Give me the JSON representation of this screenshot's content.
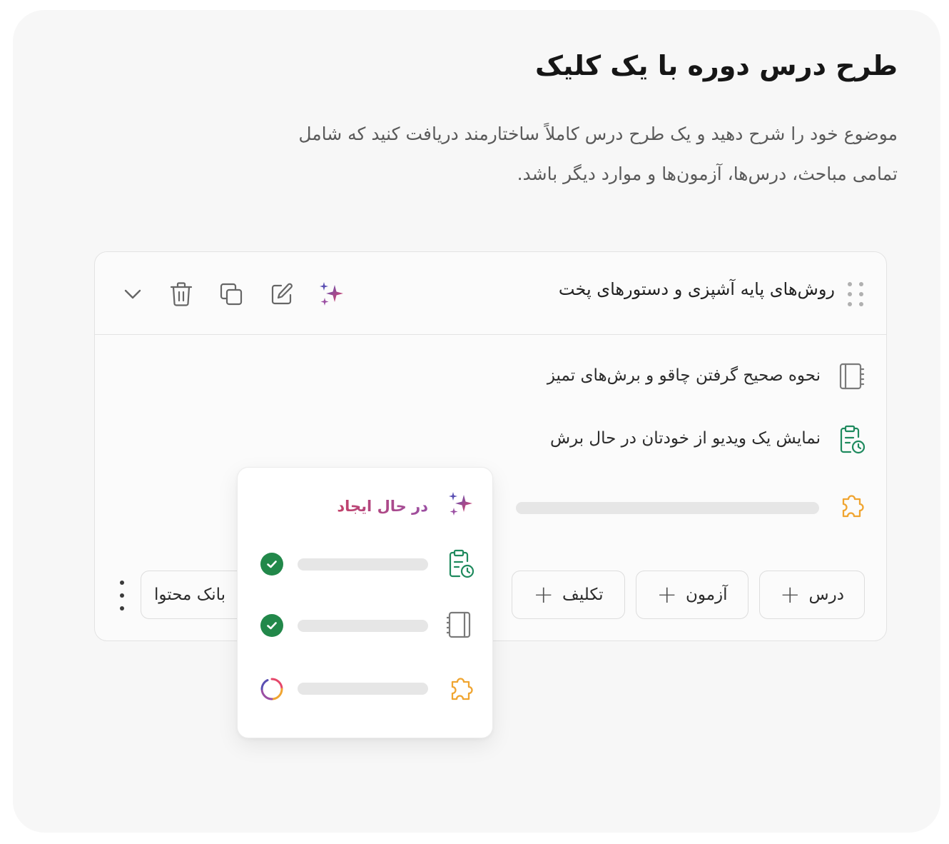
{
  "hero": {
    "title": "طرح درس دوره با یک کلیک",
    "description": "موضوع خود را شرح دهید و یک طرح درس کاملاً ساختارمند دریافت کنید که شامل تمامی مباحث، درس‌ها، آزمون‌ها و موارد دیگر باشد."
  },
  "module": {
    "title": "روش‌های پایه آشپزی و دستورهای پخت",
    "toolbar": [
      "sparkles-icon",
      "edit-icon",
      "duplicate-icon",
      "delete-icon",
      "chevron-down-icon"
    ],
    "items": [
      {
        "icon": "notebook-icon",
        "label": "نحوه صحیح گرفتن چاقو و برش‌های تمیز"
      },
      {
        "icon": "clipboard-clock-icon",
        "label": "نمایش یک ویدیو از خودتان در حال برش"
      },
      {
        "icon": "puzzle-icon",
        "label": ""
      }
    ],
    "actions": {
      "lesson": "درس",
      "quiz": "آزمون",
      "assignment": "تکلیف",
      "content_bank": "بانک محتوا"
    }
  },
  "generation_popup": {
    "status": "در حال ایجاد",
    "steps": [
      {
        "icon": "clipboard-clock-icon",
        "state": "done"
      },
      {
        "icon": "notebook-icon",
        "state": "done"
      },
      {
        "icon": "puzzle-icon",
        "state": "loading"
      }
    ]
  },
  "colors": {
    "accent_green": "#22884a",
    "icon_green": "#1f8a5e",
    "puzzle_orange": "#f0a531",
    "gradient_start": "#c2426a",
    "gradient_end": "#9b4fa3"
  }
}
